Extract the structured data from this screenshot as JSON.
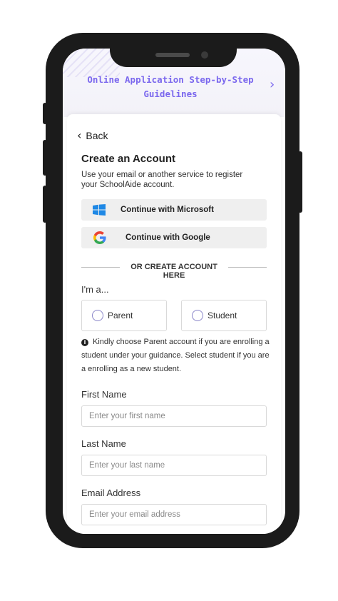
{
  "banner": {
    "title_line1": "Online Application Step-by-Step",
    "title_line2": "Guidelines",
    "chevron": "›"
  },
  "nav": {
    "back_label": "Back"
  },
  "form": {
    "heading": "Create an Account",
    "subtext": "Use your email or another service to register your SchoolAide account.",
    "microsoft_button": "Continue with Microsoft",
    "google_button": "Continue with Google",
    "divider": "OR CREATE ACCOUNT HERE",
    "role_prompt": "I'm a...",
    "roles": [
      {
        "label": "Parent",
        "selected": false
      },
      {
        "label": "Student",
        "selected": false
      }
    ],
    "info_text": "Kindly choose Parent account if you are enrolling a student under your guidance. Select student if you are a enrolling as a new student.",
    "fields": {
      "first_name": {
        "label": "First Name",
        "placeholder": "Enter your first name",
        "value": ""
      },
      "last_name": {
        "label": "Last Name",
        "placeholder": "Enter your last name",
        "value": ""
      },
      "email": {
        "label": "Email Address",
        "placeholder": "Enter your email address",
        "value": ""
      }
    }
  },
  "colors": {
    "accent": "#7b68ee",
    "button_bg": "#efefef",
    "border": "#d9d9d9"
  }
}
